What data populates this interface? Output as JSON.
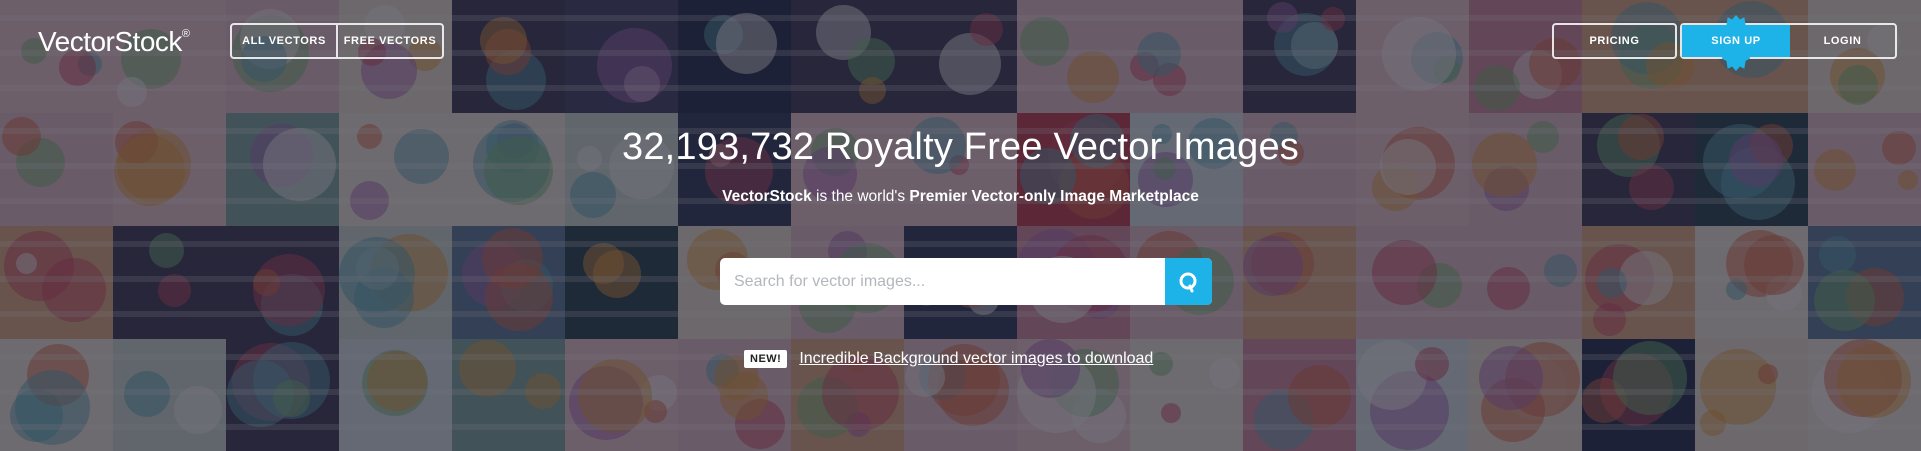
{
  "header": {
    "logo_text": "VectorStock",
    "logo_mark": "®",
    "nav": {
      "all_vectors": "ALL VECTORS",
      "free_vectors": "FREE VECTORS"
    },
    "pricing": "PRICING",
    "sign_up": "SIGN UP",
    "login": "LOGIN"
  },
  "hero": {
    "headline": "32,193,732 Royalty Free Vector Images",
    "sub_brand": "VectorStock",
    "sub_middle": " is the world's ",
    "sub_bold": "Premier Vector-only Image Marketplace"
  },
  "search": {
    "placeholder": "Search for vector images...",
    "value": "",
    "icon": "search-icon"
  },
  "promo": {
    "badge": "NEW!",
    "link_text": "Incredible Background vector images to download"
  },
  "colors": {
    "accent": "#1eb3e8",
    "overlay": "#1c1a28"
  }
}
